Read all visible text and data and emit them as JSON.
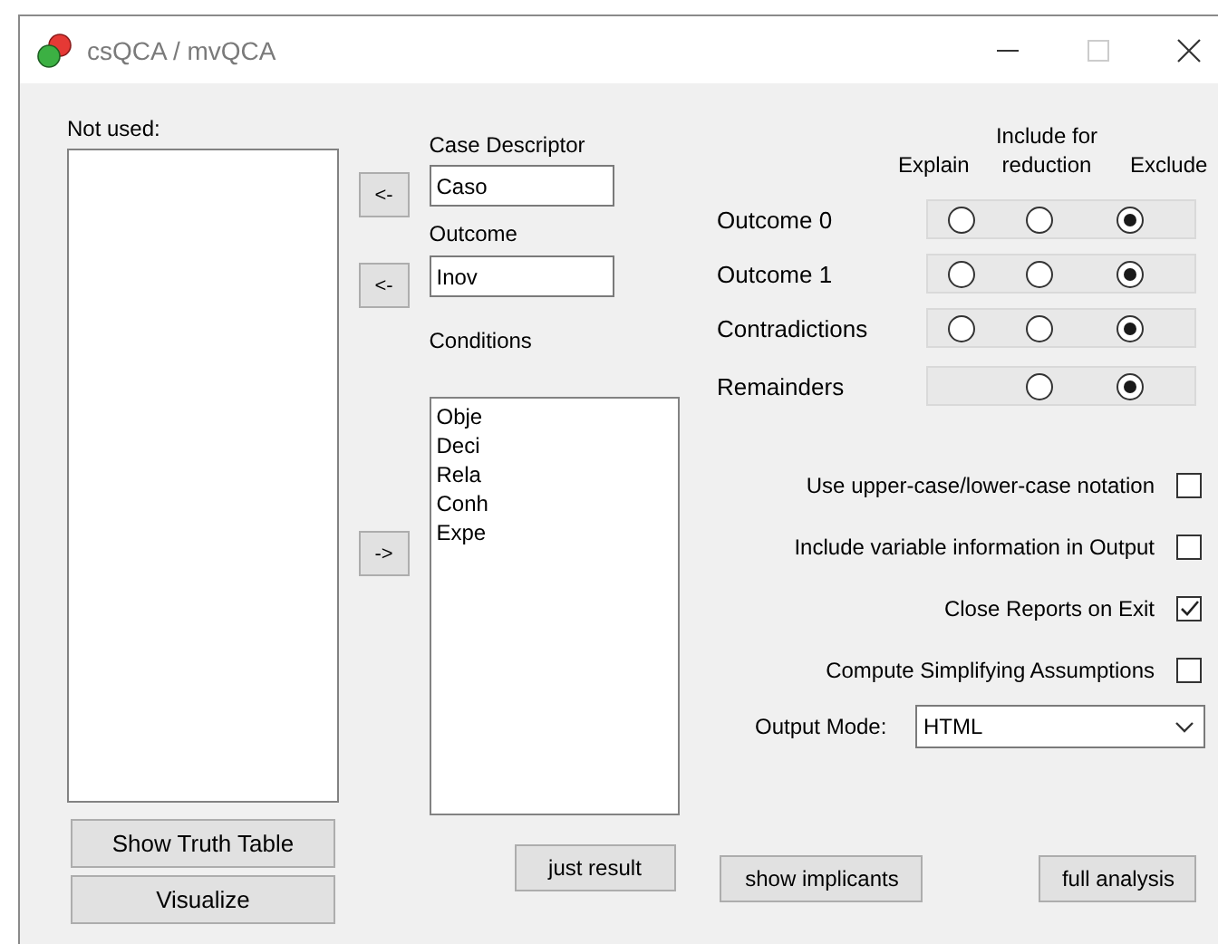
{
  "window": {
    "title": "csQCA / mvQCA"
  },
  "not_used": {
    "label": "Not used:"
  },
  "case_descriptor": {
    "label": "Case Descriptor",
    "value": "Caso",
    "button": "<-"
  },
  "outcome": {
    "label": "Outcome",
    "value": "Inov",
    "button": "<-"
  },
  "conditions": {
    "label": "Conditions",
    "items": [
      "Obje",
      "Deci",
      "Rela",
      "Conh",
      "Expe"
    ],
    "button": "->"
  },
  "minimization": {
    "columns": [
      "Explain",
      "Include for reduction",
      "Exclude"
    ],
    "rows": [
      {
        "label": "Outcome 0",
        "kind": "full",
        "choices": [
          {
            "selected": false
          },
          {
            "selected": false
          },
          {
            "selected": true
          }
        ]
      },
      {
        "label": "Outcome 1",
        "kind": "full",
        "choices": [
          {
            "selected": false
          },
          {
            "selected": false
          },
          {
            "selected": true
          }
        ]
      },
      {
        "label": "Contradictions",
        "kind": "full",
        "choices": [
          {
            "selected": false
          },
          {
            "selected": false
          },
          {
            "selected": true
          }
        ]
      },
      {
        "label": "Remainders",
        "kind": "no_explain",
        "choices": [
          {
            "selected": false
          },
          {
            "selected": true
          }
        ]
      }
    ]
  },
  "checkboxes": [
    {
      "label": "Use upper-case/lower-case notation",
      "checked": false
    },
    {
      "label": "Include variable information in Output",
      "checked": false
    },
    {
      "label": "Close Reports on Exit",
      "checked": true
    },
    {
      "label": "Compute Simplifying Assumptions",
      "checked": false
    }
  ],
  "output_mode": {
    "label": "Output Mode:",
    "value": "HTML"
  },
  "left_buttons": [
    "Show Truth Table",
    "Visualize"
  ],
  "bottom_buttons": [
    "just result",
    "show implicants",
    "full analysis"
  ]
}
